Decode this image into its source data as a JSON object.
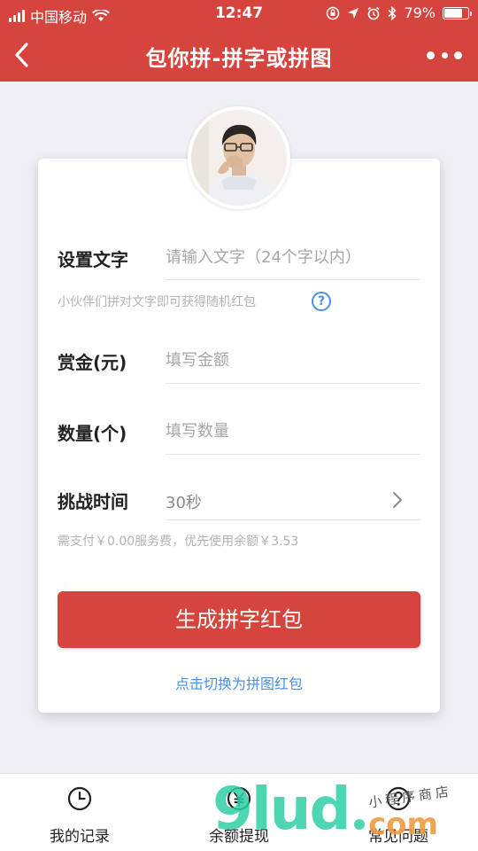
{
  "status_bar": {
    "carrier": "中国移动",
    "time": "12:47",
    "battery": "79%",
    "battery_level": 0.79
  },
  "nav": {
    "title": "包你拼-拼字或拼图"
  },
  "form": {
    "text_label": "设置文字",
    "text_placeholder": "请输入文字（24个字以内）",
    "text_hint": "小伙伴们拼对文字即可获得随机红包",
    "reward_label": "赏金(元)",
    "reward_placeholder": "填写金额",
    "quantity_label": "数量(个)",
    "quantity_placeholder": "填写数量",
    "time_label": "挑战时间",
    "time_value": "30秒",
    "fee_hint": "需支付￥0.00服务费，优先使用余额￥3.53",
    "submit_label": "生成拼字红包",
    "switch_label": "点击切换为拼图红包"
  },
  "tabbar": {
    "items": [
      {
        "label": "我的记录",
        "icon": "clock-icon"
      },
      {
        "label": "余额提现",
        "icon": "yuan-icon"
      },
      {
        "label": "常见问题",
        "icon": "question-icon"
      }
    ]
  },
  "watermark": {
    "brand": "9lud",
    "suffix": "com",
    "tagline": "小程序商店"
  },
  "colors": {
    "brand_red": "#d5453e",
    "link_blue": "#4a90e2",
    "watermark_green": "#2ecfa4",
    "watermark_orange": "#f09a3e"
  }
}
